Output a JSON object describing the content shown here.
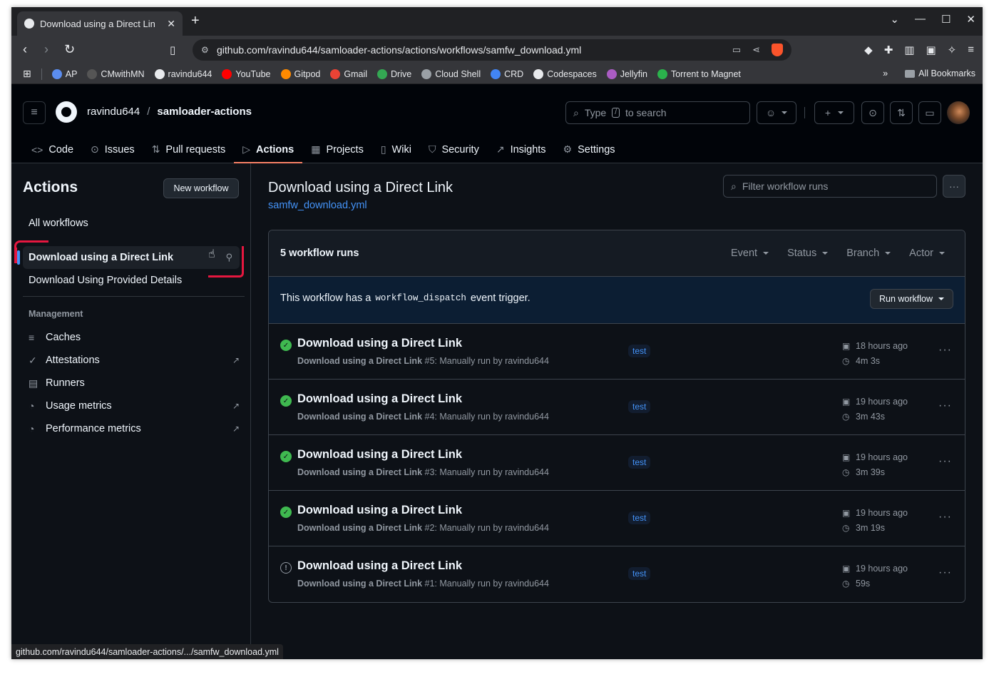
{
  "browser": {
    "tab_title": "Download using a Direct Lin",
    "url": "github.com/ravindu644/samloader-actions/actions/workflows/samfw_download.yml",
    "bookmarks": [
      {
        "label": "AP",
        "icon": "ap-icon",
        "color": "#5b8def"
      },
      {
        "label": "CMwithMN",
        "icon": "cmwithmn-icon",
        "color": "#555555"
      },
      {
        "label": "ravindu644",
        "icon": "github-icon",
        "color": "#e8eaed"
      },
      {
        "label": "YouTube",
        "icon": "youtube-icon",
        "color": "#ff0000"
      },
      {
        "label": "Gitpod",
        "icon": "gitpod-icon",
        "color": "#ff8a00"
      },
      {
        "label": "Gmail",
        "icon": "gmail-icon",
        "color": "#ea4335"
      },
      {
        "label": "Drive",
        "icon": "drive-icon",
        "color": "#34a853"
      },
      {
        "label": "Cloud Shell",
        "icon": "cloud-shell-icon",
        "color": "#9aa0a6"
      },
      {
        "label": "CRD",
        "icon": "crd-icon",
        "color": "#4285f4"
      },
      {
        "label": "Codespaces",
        "icon": "codespaces-icon",
        "color": "#e8eaed"
      },
      {
        "label": "Jellyfin",
        "icon": "jellyfin-icon",
        "color": "#aa5cc3"
      },
      {
        "label": "Torrent to Magnet",
        "icon": "torrent-icon",
        "color": "#2bb24c"
      }
    ],
    "all_bookmarks": "All Bookmarks",
    "status_url": "github.com/ravindu644/samloader-actions/.../samfw_download.yml"
  },
  "header": {
    "owner": "ravindu644",
    "separator": "/",
    "repo": "samloader-actions",
    "search_prefix": "Type",
    "search_key": "/",
    "search_suffix": "to search"
  },
  "repo_nav": [
    {
      "label": "Code",
      "icon": "code-icon",
      "glyph": "<>"
    },
    {
      "label": "Issues",
      "icon": "issue-icon",
      "glyph": "⊙"
    },
    {
      "label": "Pull requests",
      "icon": "pull-request-icon",
      "glyph": "⇅"
    },
    {
      "label": "Actions",
      "icon": "play-icon",
      "glyph": "▷"
    },
    {
      "label": "Projects",
      "icon": "table-icon",
      "glyph": "▦"
    },
    {
      "label": "Wiki",
      "icon": "book-icon",
      "glyph": "▯"
    },
    {
      "label": "Security",
      "icon": "shield-icon",
      "glyph": "⛉"
    },
    {
      "label": "Insights",
      "icon": "graph-icon",
      "glyph": "↗"
    },
    {
      "label": "Settings",
      "icon": "gear-icon",
      "glyph": "⚙"
    }
  ],
  "sidebar": {
    "title": "Actions",
    "new_workflow": "New workflow",
    "all_workflows": "All workflows",
    "workflows": [
      "Download using a Direct Link",
      "Download Using Provided Details"
    ],
    "management_label": "Management",
    "management": [
      {
        "label": "Caches",
        "icon": "database-icon",
        "glyph": "≡",
        "external": false
      },
      {
        "label": "Attestations",
        "icon": "verified-icon",
        "glyph": "✓",
        "external": true
      },
      {
        "label": "Runners",
        "icon": "server-icon",
        "glyph": "▤",
        "external": false
      },
      {
        "label": "Usage metrics",
        "icon": "meter-icon",
        "glyph": "◔",
        "external": true
      },
      {
        "label": "Performance metrics",
        "icon": "meter-icon",
        "glyph": "◔",
        "external": true
      }
    ]
  },
  "main": {
    "title": "Download using a Direct Link",
    "file_link": "samfw_download.yml",
    "filter_placeholder": "Filter workflow runs",
    "run_count": "5 workflow runs",
    "filters": [
      "Event",
      "Status",
      "Branch",
      "Actor"
    ],
    "dispatch_prefix": "This workflow has a",
    "dispatch_code": "workflow_dispatch",
    "dispatch_suffix": "event trigger.",
    "run_workflow": "Run workflow",
    "runs": [
      {
        "title": "Download using a Direct Link",
        "sub_bold": "Download using a Direct Link",
        "sub_rest": "#5: Manually run by ravindu644",
        "branch": "test",
        "when": "18 hours ago",
        "duration": "4m 3s",
        "status": "success"
      },
      {
        "title": "Download using a Direct Link",
        "sub_bold": "Download using a Direct Link",
        "sub_rest": "#4: Manually run by ravindu644",
        "branch": "test",
        "when": "19 hours ago",
        "duration": "3m 43s",
        "status": "success"
      },
      {
        "title": "Download using a Direct Link",
        "sub_bold": "Download using a Direct Link",
        "sub_rest": "#3: Manually run by ravindu644",
        "branch": "test",
        "when": "19 hours ago",
        "duration": "3m 39s",
        "status": "success"
      },
      {
        "title": "Download using a Direct Link",
        "sub_bold": "Download using a Direct Link",
        "sub_rest": "#2: Manually run by ravindu644",
        "branch": "test",
        "when": "19 hours ago",
        "duration": "3m 19s",
        "status": "success"
      },
      {
        "title": "Download using a Direct Link",
        "sub_bold": "Download using a Direct Link",
        "sub_rest": "#1: Manually run by ravindu644",
        "branch": "test",
        "when": "19 hours ago",
        "duration": "59s",
        "status": "neutral"
      }
    ]
  },
  "colors": {
    "accent": "#4493f8",
    "success": "#3fb950",
    "annotation": "#e5173f",
    "active_tab": "#f78166"
  }
}
